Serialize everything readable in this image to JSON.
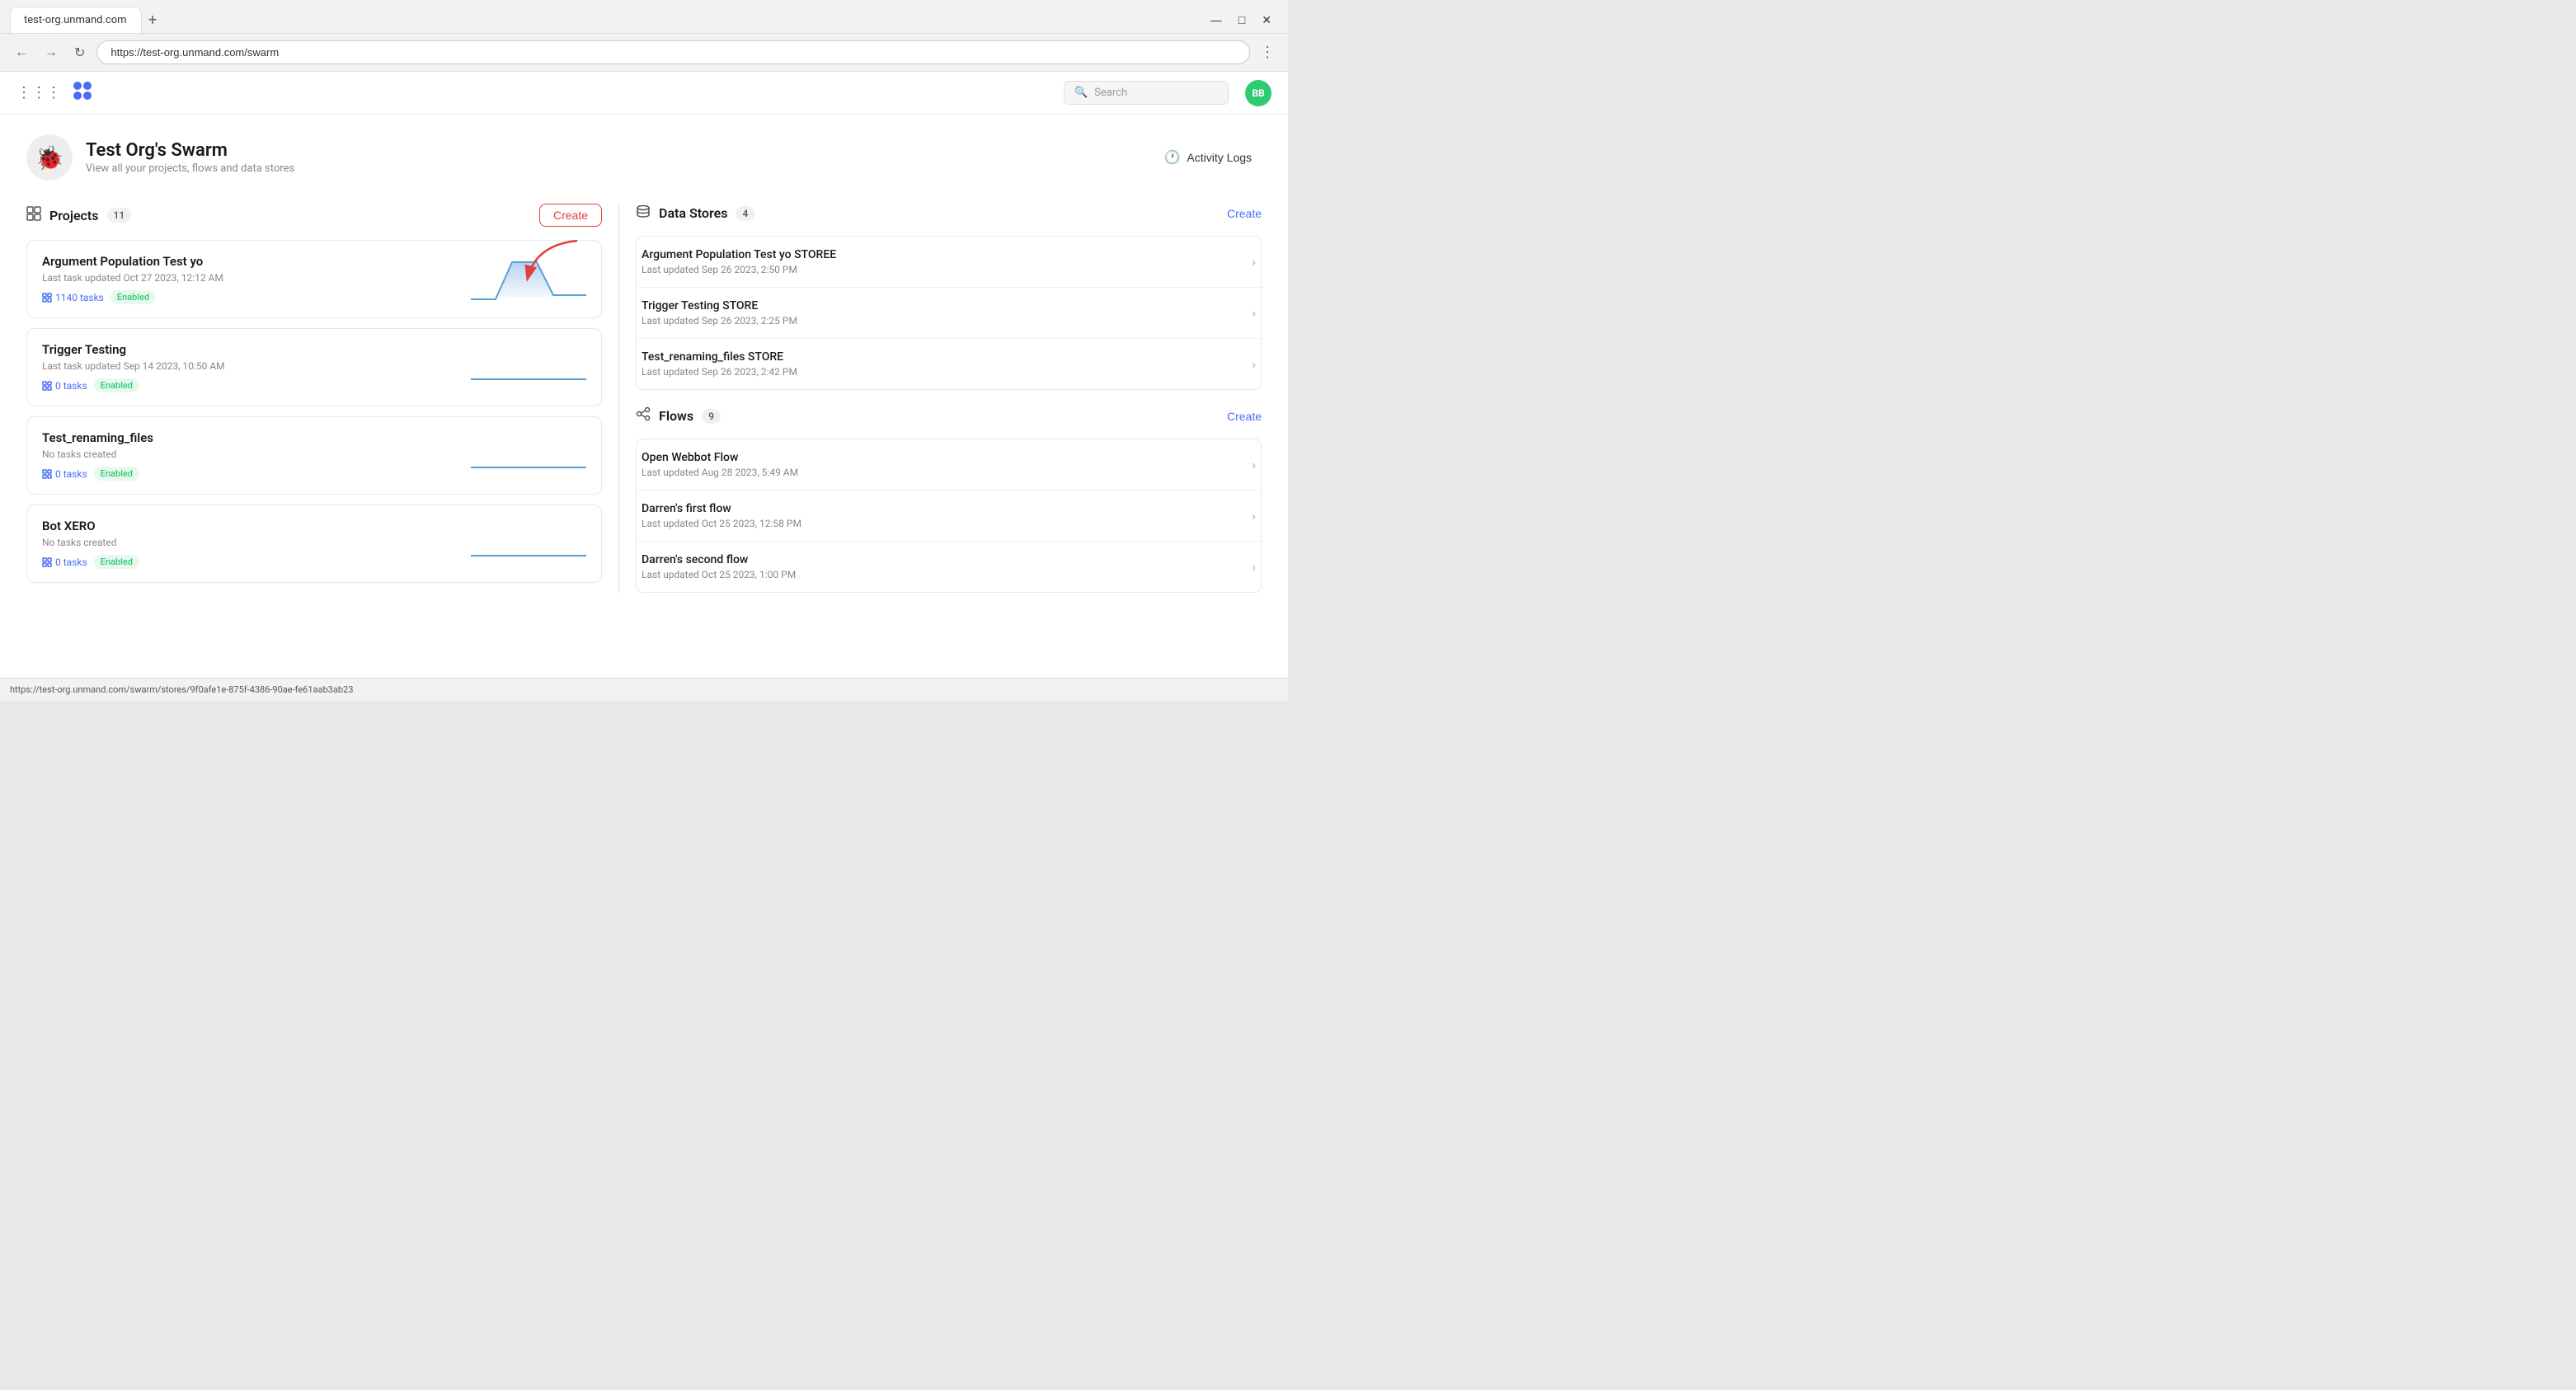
{
  "browser": {
    "tab_label": "test-org.unmand.com",
    "new_tab_symbol": "+",
    "address": "https://test-org.unmand.com/swarm",
    "window_controls": {
      "minimize": "—",
      "maximize": "□",
      "close": "✕"
    },
    "status_bar_url": "https://test-org.unmand.com/swarm/stores/9f0afe1e-875f-4386-90ae-fe61aab3ab23"
  },
  "header": {
    "logo_symbol": "✦",
    "search_placeholder": "Search",
    "avatar_initials": "BB"
  },
  "org": {
    "name": "Test Org's Swarm",
    "description": "View all your projects, flows and data stores",
    "avatar_emoji": "🐞",
    "activity_logs_label": "Activity Logs"
  },
  "projects_section": {
    "title": "Projects",
    "count": "11",
    "create_label": "Create",
    "items": [
      {
        "name": "Argument Population Test yo",
        "meta": "Last task updated Oct 27 2023, 12:12 AM",
        "tasks_label": "1140 tasks",
        "status": "Enabled",
        "chart_type": "hill"
      },
      {
        "name": "Trigger Testing",
        "meta": "Last task updated Sep 14 2023, 10:50 AM",
        "tasks_label": "0 tasks",
        "status": "Enabled",
        "chart_type": "flat"
      },
      {
        "name": "Test_renaming_files",
        "meta": "No tasks created",
        "tasks_label": "0 tasks",
        "status": "Enabled",
        "chart_type": "flat"
      },
      {
        "name": "Bot XERO",
        "meta": "No tasks created",
        "tasks_label": "0 tasks",
        "status": "Enabled",
        "chart_type": "flat"
      }
    ]
  },
  "data_stores_section": {
    "title": "Data Stores",
    "count": "4",
    "create_label": "Create",
    "items": [
      {
        "name": "Argument Population Test yo STOREE",
        "meta": "Last updated Sep 26 2023, 2:50 PM"
      },
      {
        "name": "Trigger Testing STORE",
        "meta": "Last updated Sep 26 2023, 2:25 PM"
      },
      {
        "name": "Test_renaming_files STORE",
        "meta": "Last updated Sep 26 2023, 2:42 PM"
      }
    ]
  },
  "flows_section": {
    "title": "Flows",
    "count": "9",
    "create_label": "Create",
    "items": [
      {
        "name": "Open Webbot Flow",
        "meta": "Last updated Aug 28 2023, 5:49 AM"
      },
      {
        "name": "Darren's first flow",
        "meta": "Last updated Oct 25 2023, 12:58 PM"
      },
      {
        "name": "Darren's second flow",
        "meta": "Last updated Oct 25 2023, 1:00 PM"
      }
    ]
  }
}
